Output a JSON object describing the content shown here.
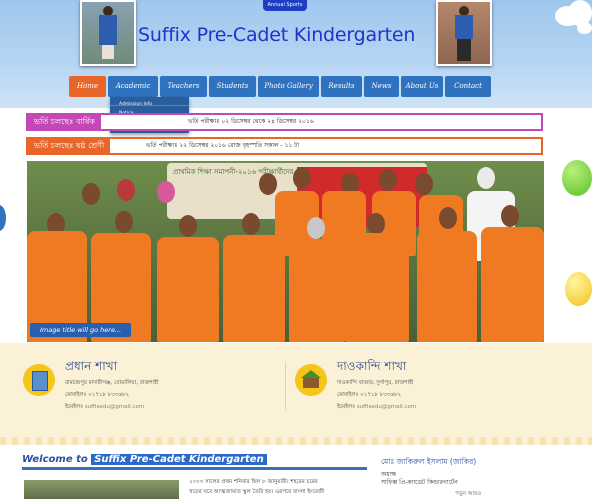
{
  "header": {
    "ribbon": "Annual Sports",
    "title": "Suffix Pre-Cadet Kindergarten"
  },
  "nav": {
    "items": [
      {
        "label": "Home",
        "active": true
      },
      {
        "label": "Academic",
        "active": false
      },
      {
        "label": "Teachers",
        "active": false
      },
      {
        "label": "Students",
        "active": false
      },
      {
        "label": "Photo Gallery",
        "active": false
      },
      {
        "label": "Results",
        "active": false
      },
      {
        "label": "News",
        "active": false
      },
      {
        "label": "About Us",
        "active": false
      },
      {
        "label": "Contact",
        "active": false
      }
    ],
    "dropdown": [
      "Admission Info",
      "Notice"
    ]
  },
  "notices": [
    {
      "tag": "ভর্তি চলছেঃ বার্ষিক",
      "text": "ভর্তি পরীক্ষাঃ ০২ ডিসেম্বর থেকে ২৪ ডিসেম্বর ২০১৬",
      "color": "#c447b7"
    },
    {
      "tag": "ভর্তি চলছেঃ ষষ্ঠ শ্রেণী",
      "text": "ভর্তি পরীক্ষাঃ ২২ ডিসেম্বর ২০১৬ রোজ বৃহস্পতি সকাল - ১১ টা",
      "color": "#e8662a"
    }
  ],
  "slider": {
    "banner_text": "প্রাথমিক শিক্ষা সমাপনী-২০১৬ পরীক্ষার্থীদের",
    "caption": "Image title will go here..."
  },
  "branches": [
    {
      "name": "প্রধান শাখা",
      "address": "রামচন্দ্রপুর মাদারীগঞ্জ, বোয়ালিয়া, রাজশাহী",
      "mobile": "মোবাইলঃ ০১৭১৮ ৮৩৩৬৮২",
      "email_label": "ইমেইলঃ",
      "email": "suffixedu@gmail.com"
    },
    {
      "name": "দাওকান্দি শাখা",
      "address": "দাওকান্দি বাজার, দুর্গাপুর, রাজশাহী",
      "mobile": "মোবাইলঃ ০১৭১৮ ৮৩৩৬৮২",
      "email_label": "ইমেইলঃ",
      "email": "suffixedu@gmail.com"
    }
  ],
  "welcome": {
    "prefix": "Welcome to",
    "highlight": "Suffix Pre-Cadet Kindergarten",
    "line1": "২০০৩ সালের প্রথম শনিবার ছিল ৮ জানুয়ারী। শহরের চরের",
    "line2": "খড়ের ঘরে আত্মজামাত স্কুল তৈরি হয়। এরপরে বাংলা ইংরেজী"
  },
  "sidebar": {
    "name": "মোঃ জাকিরুল ইসলাম (জাকির)",
    "role": "অধ্যক্ষ",
    "org": "সাফিক্স প্রি-ক্যাডেট কিন্ডারগার্টেন",
    "more": "পড়ুন আরও"
  }
}
